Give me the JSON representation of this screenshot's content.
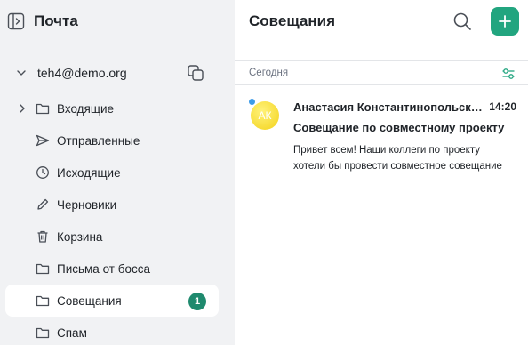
{
  "sidebar": {
    "title": "Почта",
    "account": "teh4@demo.org",
    "folders": [
      {
        "label": "Входящие",
        "icon": "folder-icon",
        "expandable": true
      },
      {
        "label": "Отправленные",
        "icon": "paper-plane-icon"
      },
      {
        "label": "Исходящие",
        "icon": "clock-icon"
      },
      {
        "label": "Черновики",
        "icon": "pencil-icon"
      },
      {
        "label": "Корзина",
        "icon": "trash-icon"
      },
      {
        "label": "Письма от босса",
        "icon": "folder-icon"
      },
      {
        "label": "Совещания",
        "icon": "folder-icon",
        "active": true,
        "badge": "1"
      },
      {
        "label": "Спам",
        "icon": "folder-icon"
      }
    ]
  },
  "main": {
    "title": "Совещания",
    "section": "Сегодня",
    "message": {
      "avatar": "АК",
      "sender": "Анастасия Константинопольская",
      "time": "14:20",
      "subject": "Совещание по совместному проекту",
      "preview_line1": "Привет всем! Наши коллеги по проекту",
      "preview_line2": "хотели бы провести совместное совещание",
      "unread": true
    }
  },
  "colors": {
    "accent": "#22a57f",
    "badge": "#1f8a6e",
    "unread_dot": "#3c9be8",
    "sidebar_bg": "#f1f2f4",
    "avatar": "#f3d21a"
  }
}
